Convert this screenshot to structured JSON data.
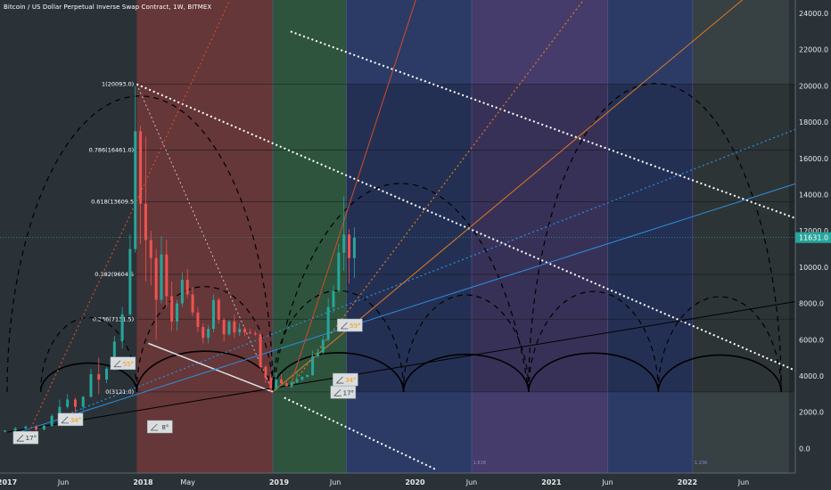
{
  "chart_data": {
    "type": "line",
    "title": "Bitcoin / US Dollar Perpetual Inverse Swap Contract, 1W, BITMEX",
    "price_ticks": [
      "24000.0",
      "22000.0",
      "20000.0",
      "18000.0",
      "16000.0",
      "14000.0",
      "12000.0",
      "10000.0",
      "8000.0",
      "6000.0",
      "4000.0",
      "2000.0",
      "0.0"
    ],
    "price_tick_values": [
      24000,
      22000,
      20000,
      18000,
      16000,
      14000,
      12000,
      10000,
      8000,
      6000,
      4000,
      2000,
      0
    ],
    "time_ticks": [
      {
        "label": "2017",
        "date": "2017-01-01",
        "bold": true
      },
      {
        "label": "Jun",
        "date": "2017-06-01",
        "bold": false
      },
      {
        "label": "2018",
        "date": "2018-01-01",
        "bold": true
      },
      {
        "label": "May",
        "date": "2018-05-01",
        "bold": false
      },
      {
        "label": "2019",
        "date": "2019-01-01",
        "bold": true
      },
      {
        "label": "Jun",
        "date": "2019-06-01",
        "bold": false
      },
      {
        "label": "2020",
        "date": "2020-01-01",
        "bold": true
      },
      {
        "label": "Jun",
        "date": "2020-06-01",
        "bold": false
      },
      {
        "label": "2021",
        "date": "2021-01-01",
        "bold": true
      },
      {
        "label": "Jun",
        "date": "2021-06-01",
        "bold": false
      },
      {
        "label": "2022",
        "date": "2022-01-01",
        "bold": true
      },
      {
        "label": "Jun",
        "date": "2022-06-01",
        "bold": false
      }
    ],
    "current_price": {
      "label": "11631.0",
      "value": 11631,
      "color": "#26a69a"
    },
    "fib_levels": [
      {
        "label": "1(20093.0)",
        "value": 20093
      },
      {
        "label": "0.786(16461.0)",
        "value": 16461
      },
      {
        "label": "0.618(13609.5",
        "value": 13609
      },
      {
        "label": "0.382(9604.5",
        "value": 9604
      },
      {
        "label": "0.236(7131.5)",
        "value": 7131
      },
      {
        "label": "0(3121.0)",
        "value": 3121
      }
    ],
    "zones": [
      {
        "from": "2017-12-15",
        "to": "2018-12-15",
        "color": "#7a3a3a",
        "opacity": 0.75
      },
      {
        "from": "2018-12-15",
        "to": "2019-07-01",
        "color": "#2f5a3e",
        "opacity": 0.85
      },
      {
        "from": "2019-07-01",
        "to": "2020-06-01",
        "color": "#2e3f75",
        "opacity": 0.75
      },
      {
        "from": "2020-06-01",
        "to": "2021-06-01",
        "color": "#4c3f78",
        "opacity": 0.8
      },
      {
        "from": "2021-06-01",
        "to": "2022-01-15",
        "color": "#2e3f75",
        "opacity": 0.75
      },
      {
        "from": "2022-01-15",
        "to": "2022-10-01",
        "color": "#3b4446",
        "opacity": 0.8
      }
    ],
    "zone_labels": [
      {
        "text": "1.618",
        "date": "2020-06-05",
        "price": 0
      },
      {
        "text": "1.236",
        "date": "2022-01-20",
        "price": 0
      }
    ],
    "candles": [
      {
        "date": "2016-12-26",
        "o": 930,
        "h": 1000,
        "l": 900,
        "c": 990
      },
      {
        "date": "2017-01-23",
        "o": 990,
        "h": 1200,
        "l": 880,
        "c": 1100
      },
      {
        "date": "2017-02-20",
        "o": 1100,
        "h": 1280,
        "l": 1050,
        "c": 1200
      },
      {
        "date": "2017-03-20",
        "o": 1200,
        "h": 1290,
        "l": 900,
        "c": 1050
      },
      {
        "date": "2017-04-10",
        "o": 1050,
        "h": 1300,
        "l": 1000,
        "c": 1250
      },
      {
        "date": "2017-05-01",
        "o": 1250,
        "h": 1900,
        "l": 1200,
        "c": 1800
      },
      {
        "date": "2017-05-22",
        "o": 1800,
        "h": 2700,
        "l": 1800,
        "c": 2300
      },
      {
        "date": "2017-06-12",
        "o": 2300,
        "h": 3000,
        "l": 2200,
        "c": 2700
      },
      {
        "date": "2017-07-03",
        "o": 2700,
        "h": 2800,
        "l": 1900,
        "c": 2300
      },
      {
        "date": "2017-07-24",
        "o": 2300,
        "h": 2900,
        "l": 2100,
        "c": 2850
      },
      {
        "date": "2017-08-14",
        "o": 2850,
        "h": 4400,
        "l": 2800,
        "c": 4100
      },
      {
        "date": "2017-09-04",
        "o": 4100,
        "h": 5000,
        "l": 3000,
        "c": 3800
      },
      {
        "date": "2017-09-25",
        "o": 3800,
        "h": 4500,
        "l": 3600,
        "c": 4400
      },
      {
        "date": "2017-10-16",
        "o": 4400,
        "h": 6200,
        "l": 4300,
        "c": 5900
      },
      {
        "date": "2017-11-06",
        "o": 5900,
        "h": 7800,
        "l": 5500,
        "c": 7400
      },
      {
        "date": "2017-11-27",
        "o": 7400,
        "h": 11800,
        "l": 7300,
        "c": 11000
      },
      {
        "date": "2017-12-11",
        "o": 11000,
        "h": 20000,
        "l": 10800,
        "c": 17500
      },
      {
        "date": "2017-12-25",
        "o": 17500,
        "h": 17800,
        "l": 11300,
        "c": 13500
      },
      {
        "date": "2018-01-08",
        "o": 13500,
        "h": 17200,
        "l": 9200,
        "c": 11500
      },
      {
        "date": "2018-01-22",
        "o": 11500,
        "h": 12000,
        "l": 9000,
        "c": 10500
      },
      {
        "date": "2018-02-05",
        "o": 10500,
        "h": 11000,
        "l": 6000,
        "c": 8200
      },
      {
        "date": "2018-02-19",
        "o": 8200,
        "h": 11700,
        "l": 8000,
        "c": 10700
      },
      {
        "date": "2018-03-05",
        "o": 10700,
        "h": 11500,
        "l": 7800,
        "c": 8400
      },
      {
        "date": "2018-03-19",
        "o": 8400,
        "h": 9200,
        "l": 6500,
        "c": 7000
      },
      {
        "date": "2018-04-02",
        "o": 7000,
        "h": 8200,
        "l": 6500,
        "c": 8000
      },
      {
        "date": "2018-04-16",
        "o": 8000,
        "h": 9700,
        "l": 7800,
        "c": 9300
      },
      {
        "date": "2018-04-30",
        "o": 9300,
        "h": 9900,
        "l": 8300,
        "c": 8500
      },
      {
        "date": "2018-05-14",
        "o": 8500,
        "h": 8900,
        "l": 7300,
        "c": 7500
      },
      {
        "date": "2018-05-28",
        "o": 7500,
        "h": 7800,
        "l": 6400,
        "c": 6700
      },
      {
        "date": "2018-06-11",
        "o": 6700,
        "h": 6900,
        "l": 5800,
        "c": 6100
      },
      {
        "date": "2018-06-25",
        "o": 6100,
        "h": 6800,
        "l": 5800,
        "c": 6600
      },
      {
        "date": "2018-07-09",
        "o": 6600,
        "h": 8500,
        "l": 6400,
        "c": 8200
      },
      {
        "date": "2018-07-23",
        "o": 8200,
        "h": 8300,
        "l": 6900,
        "c": 7100
      },
      {
        "date": "2018-08-06",
        "o": 7100,
        "h": 7200,
        "l": 5900,
        "c": 6300
      },
      {
        "date": "2018-08-20",
        "o": 6300,
        "h": 7100,
        "l": 6200,
        "c": 7000
      },
      {
        "date": "2018-09-03",
        "o": 7000,
        "h": 7400,
        "l": 6100,
        "c": 6400
      },
      {
        "date": "2018-09-17",
        "o": 6400,
        "h": 6900,
        "l": 6200,
        "c": 6600
      },
      {
        "date": "2018-10-01",
        "o": 6600,
        "h": 6700,
        "l": 6200,
        "c": 6400
      },
      {
        "date": "2018-10-15",
        "o": 6400,
        "h": 6600,
        "l": 6300,
        "c": 6350
      },
      {
        "date": "2018-10-29",
        "o": 6350,
        "h": 6500,
        "l": 6200,
        "c": 6300
      },
      {
        "date": "2018-11-12",
        "o": 6300,
        "h": 6400,
        "l": 4300,
        "c": 4500
      },
      {
        "date": "2018-11-26",
        "o": 4500,
        "h": 4600,
        "l": 3600,
        "c": 3900
      },
      {
        "date": "2018-12-10",
        "o": 3900,
        "h": 4100,
        "l": 3100,
        "c": 3300
      },
      {
        "date": "2018-12-24",
        "o": 3300,
        "h": 4200,
        "l": 3200,
        "c": 3800
      },
      {
        "date": "2019-01-07",
        "o": 3800,
        "h": 4100,
        "l": 3500,
        "c": 3600
      },
      {
        "date": "2019-01-21",
        "o": 3600,
        "h": 3700,
        "l": 3400,
        "c": 3450
      },
      {
        "date": "2019-02-04",
        "o": 3450,
        "h": 3700,
        "l": 3350,
        "c": 3650
      },
      {
        "date": "2019-02-18",
        "o": 3650,
        "h": 4200,
        "l": 3600,
        "c": 3800
      },
      {
        "date": "2019-03-04",
        "o": 3800,
        "h": 4000,
        "l": 3700,
        "c": 3950
      },
      {
        "date": "2019-03-18",
        "o": 3950,
        "h": 4100,
        "l": 3900,
        "c": 4050
      },
      {
        "date": "2019-04-01",
        "o": 4050,
        "h": 5400,
        "l": 4000,
        "c": 5100
      },
      {
        "date": "2019-04-15",
        "o": 5100,
        "h": 5500,
        "l": 5000,
        "c": 5300
      },
      {
        "date": "2019-04-29",
        "o": 5300,
        "h": 6200,
        "l": 5200,
        "c": 6000
      },
      {
        "date": "2019-05-13",
        "o": 6000,
        "h": 8300,
        "l": 5900,
        "c": 7800
      },
      {
        "date": "2019-05-27",
        "o": 7800,
        "h": 9000,
        "l": 7500,
        "c": 8700
      },
      {
        "date": "2019-06-10",
        "o": 8700,
        "h": 11300,
        "l": 8600,
        "c": 10800
      },
      {
        "date": "2019-06-24",
        "o": 10800,
        "h": 13900,
        "l": 9800,
        "c": 11800
      },
      {
        "date": "2019-07-08",
        "o": 11800,
        "h": 12100,
        "l": 9100,
        "c": 10500
      },
      {
        "date": "2019-07-22",
        "o": 10500,
        "h": 12200,
        "l": 9400,
        "c": 11631
      }
    ],
    "angle_badges": [
      {
        "text": "17°",
        "date": "2017-02-20",
        "price": 600,
        "accent": "#ffffff"
      },
      {
        "text": "34°",
        "date": "2017-06-20",
        "price": 1600,
        "accent": "#ff9800"
      },
      {
        "text": "55°",
        "date": "2017-11-08",
        "price": 4700,
        "accent": "#ff9800"
      },
      {
        "text": "8°",
        "date": "2018-02-15",
        "price": 1200,
        "accent": "#ffffff"
      },
      {
        "text": "59°",
        "date": "2019-07-10",
        "price": 6800,
        "accent": "#ff9800"
      },
      {
        "text": "34°",
        "date": "2019-06-28",
        "price": 3800,
        "accent": "#ff9800"
      },
      {
        "text": "17°",
        "date": "2019-06-22",
        "price": 3100,
        "accent": "#ffffff"
      }
    ],
    "grid": true,
    "y_axis_position": "right",
    "colors": {
      "background": "#2a3238",
      "up": "#26a69a",
      "down": "#ef5350",
      "axis_text": "#e8e8e8",
      "price_tag": "#26a69a"
    }
  }
}
